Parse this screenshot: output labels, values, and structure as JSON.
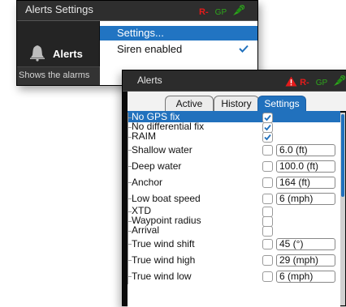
{
  "back_window": {
    "title": "Alerts Settings",
    "status": {
      "alarm": "R-",
      "gps": "GP"
    },
    "sidebar": {
      "label": "Alerts",
      "description": "Shows the alarms"
    },
    "menu": [
      {
        "label": "Settings...",
        "selected": true,
        "checked": false
      },
      {
        "label": "Siren enabled",
        "selected": false,
        "checked": true
      }
    ]
  },
  "front_window": {
    "title": "Alerts",
    "status": {
      "alarm": "R-",
      "gps": "GP"
    },
    "tabs": [
      {
        "label": "Active",
        "active": false
      },
      {
        "label": "History",
        "active": false
      },
      {
        "label": "Settings",
        "active": true
      }
    ],
    "rows": [
      {
        "label": "No GPS fix",
        "checked": true,
        "value": "",
        "selected": true
      },
      {
        "label": "No differential fix",
        "checked": true,
        "value": ""
      },
      {
        "label": "RAIM",
        "checked": true,
        "value": ""
      },
      {
        "label": "Shallow water",
        "checked": false,
        "value": "6.0 (ft)"
      },
      {
        "label": "Deep water",
        "checked": false,
        "value": "100.0 (ft)"
      },
      {
        "label": "Anchor",
        "checked": false,
        "value": "164 (ft)"
      },
      {
        "label": "Low boat speed",
        "checked": false,
        "value": "6 (mph)"
      },
      {
        "label": "XTD",
        "checked": false,
        "value": ""
      },
      {
        "label": "Waypoint radius",
        "checked": false,
        "value": ""
      },
      {
        "label": "Arrival",
        "checked": false,
        "value": ""
      },
      {
        "label": "True wind shift",
        "checked": false,
        "value": "45 (°)"
      },
      {
        "label": "True wind high",
        "checked": false,
        "value": "29 (mph)"
      },
      {
        "label": "True wind low",
        "checked": false,
        "value": "6 (mph)"
      }
    ]
  },
  "colors": {
    "accent": "#2171bd",
    "alarm": "#e41b1b",
    "gps": "#2ea61c",
    "titlebar": "#2e2e2e"
  }
}
